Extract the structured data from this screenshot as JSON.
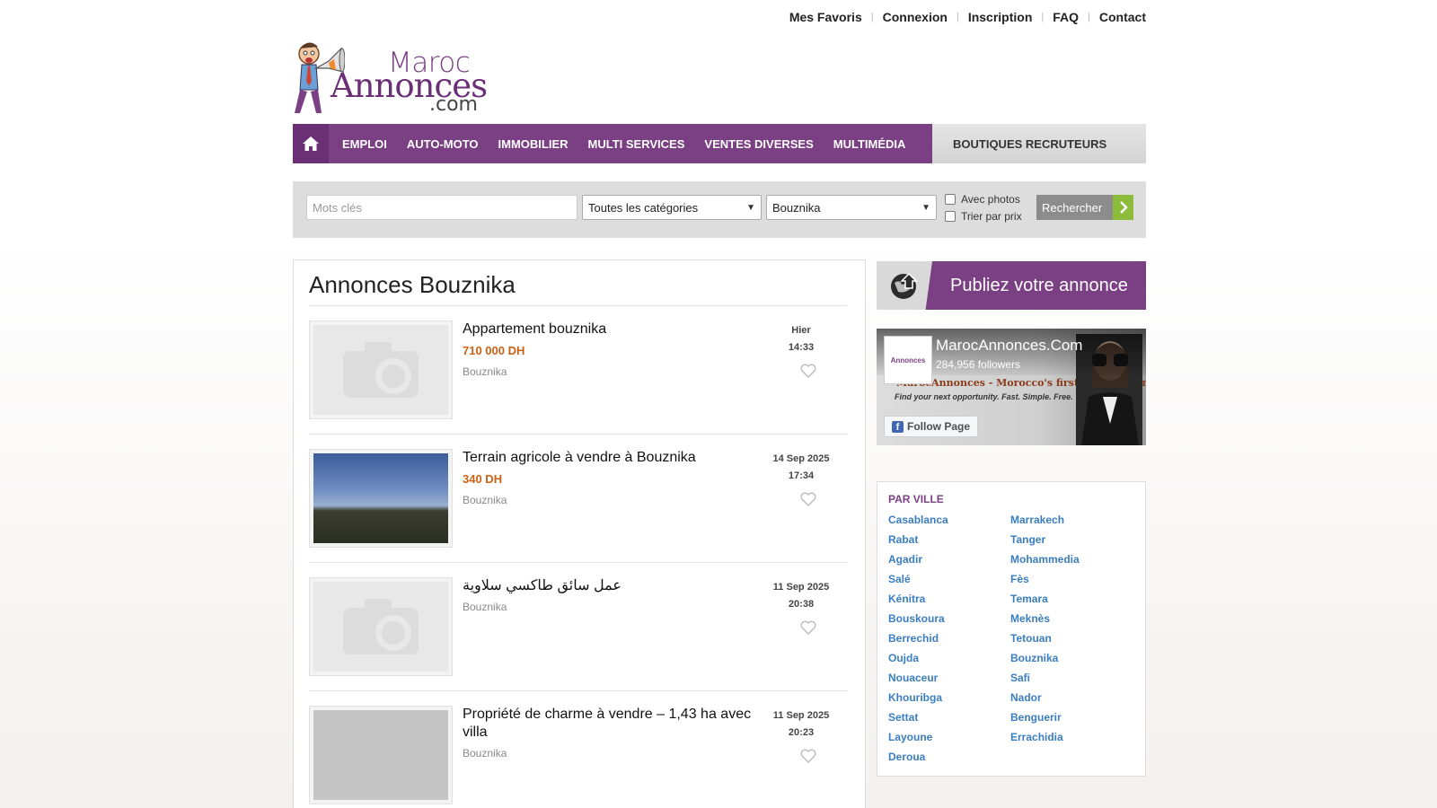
{
  "top_links": [
    "Mes Favoris",
    "Connexion",
    "Inscription",
    "FAQ",
    "Contact"
  ],
  "logo": {
    "line1": "Maroc",
    "line2": "Annonces",
    "line3": ".com"
  },
  "nav": {
    "items": [
      "EMPLOI",
      "AUTO-MOTO",
      "IMMOBILIER",
      "MULTI SERVICES",
      "VENTES DIVERSES",
      "MULTIMÉDIA"
    ],
    "extra": "BOUTIQUES RECRUTEURS"
  },
  "search": {
    "keywords_placeholder": "Mots clés",
    "category": "Toutes les catégories",
    "city": "Bouznika",
    "with_photos": "Avec photos",
    "sort_price": "Trier par prix",
    "button": "Rechercher"
  },
  "listing": {
    "heading": "Annonces Bouznika",
    "ads": [
      {
        "title": "Appartement bouznika",
        "price": "710 000 DH",
        "city": "Bouznika",
        "date": "Hier",
        "time": "14:33",
        "image": "placeholder"
      },
      {
        "title": "Terrain agricole à vendre à Bouznika",
        "price": "340 DH",
        "city": "Bouznika",
        "date": "14 Sep 2025",
        "time": "17:34",
        "image": "field-photo"
      },
      {
        "title": "عمل سائق طاكسي سلاوية",
        "price": "",
        "city": "Bouznika",
        "date": "11 Sep 2025",
        "time": "20:38",
        "image": "placeholder"
      },
      {
        "title": "Propriété de charme à vendre – 1,43 ha avec villa",
        "price": "",
        "city": "Bouznika",
        "date": "11 Sep 2025",
        "time": "20:23",
        "image": "grey"
      }
    ]
  },
  "sidebar": {
    "publish_label": "Publiez votre annonce",
    "facebook": {
      "page_name": "MarocAnnonces.Com",
      "followers": "284,956 followers",
      "follow_label": "Follow Page",
      "banner_text": "MarocAnnonces - Morocco's first Job Platform.",
      "banner_sub": "Find your next opportunity. Fast. Simple. Free."
    },
    "cities": {
      "heading": "PAR VILLE",
      "left": [
        "Casablanca",
        "Rabat",
        "Agadir",
        "Salé",
        "Kénitra",
        "Bouskoura",
        "Berrechid",
        "Oujda",
        "Nouaceur",
        "Khouribga",
        "Settat",
        "Layoune",
        "Deroua"
      ],
      "right": [
        "Marrakech",
        "Tanger",
        "Mohammedia",
        "Fès",
        "Temara",
        "Meknès",
        "Tetouan",
        "Bouznika",
        "Safi",
        "Nador",
        "Benguerir",
        "Errachidia"
      ]
    }
  },
  "colors": {
    "brand_purple": "#7b3f84",
    "price_orange": "#c86114",
    "link_blue": "#3a7ebf",
    "go_green": "#8dbb3a"
  }
}
